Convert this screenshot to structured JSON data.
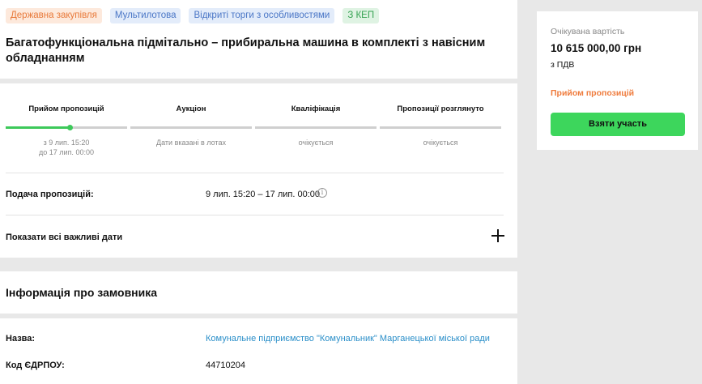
{
  "header": {
    "tags": [
      "Державна закупівля",
      "Мультилотова",
      "Відкриті торги з особливостями",
      "З КЕП"
    ],
    "title": "Багатофункціональна підмітально – прибиральна машина в комплекті з навісним обладнанням"
  },
  "steps": [
    {
      "label": "Прийом пропозицій",
      "sub1": "з 9 лип. 15:20",
      "sub2": "до 17 лип. 00:00",
      "progress": 0.53
    },
    {
      "label": "Аукціон",
      "sub1": "Дати вказані в лотах",
      "sub2": "",
      "progress": 0
    },
    {
      "label": "Кваліфікація",
      "sub1": "очікується",
      "sub2": "",
      "progress": 0
    },
    {
      "label": "Пропозиції розглянуто",
      "sub1": "очікується",
      "sub2": "",
      "progress": 0
    }
  ],
  "submission": {
    "label": "Подача пропозицій:",
    "value": "9 лип. 15:20 – 17 лип. 00:00",
    "info_icon": "i"
  },
  "dates": {
    "label": "Показати всі важливі дати"
  },
  "customer": {
    "title": "Інформація про замовника",
    "name_label": "Назва:",
    "name_value": "Комунальне підприємство \"Комунальник\" Марганецької міської ради",
    "code_label": "Код ЄДРПОУ:",
    "code_value": "44710204"
  },
  "sidebar": {
    "price_label": "Очікувана вартість",
    "price": "10 615 000,00 грн",
    "vat": "з ПДВ",
    "status": "Прийом пропозицій",
    "button": "Взяти участь"
  },
  "colors": {
    "accent_green": "#3dd65c",
    "status_orange": "#ef7b3c",
    "link_blue": "#2b8fc9"
  }
}
